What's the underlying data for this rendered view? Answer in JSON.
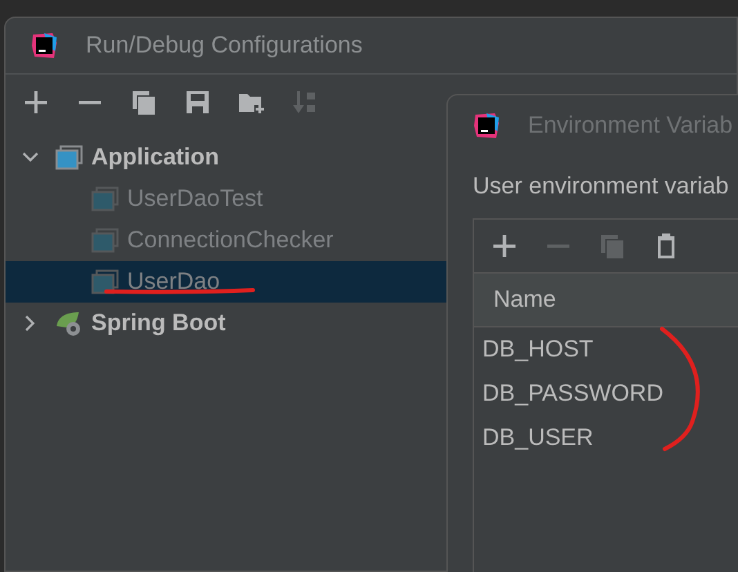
{
  "dialog": {
    "title": "Run/Debug Configurations",
    "toolbar": [
      {
        "kind": "add",
        "disabled": false
      },
      {
        "kind": "remove",
        "disabled": false
      },
      {
        "kind": "copy",
        "disabled": false
      },
      {
        "kind": "save",
        "disabled": false
      },
      {
        "kind": "folder",
        "disabled": false
      },
      {
        "kind": "sort",
        "disabled": true
      }
    ],
    "tree": [
      {
        "label": "Application",
        "kind": "application",
        "expanded": true,
        "selected": false,
        "children": [
          {
            "label": "UserDaoTest",
            "kind": "config",
            "selected": false
          },
          {
            "label": "ConnectionChecker",
            "kind": "config",
            "selected": false
          },
          {
            "label": "UserDao",
            "kind": "config",
            "selected": true
          }
        ]
      },
      {
        "label": "Spring Boot",
        "kind": "spring",
        "expanded": false,
        "selected": false
      }
    ]
  },
  "env_dialog": {
    "title": "Environment Variab",
    "label": "User environment variab",
    "toolbar": [
      {
        "kind": "add",
        "disabled": false
      },
      {
        "kind": "remove",
        "disabled": true
      },
      {
        "kind": "copy",
        "disabled": true
      },
      {
        "kind": "paste",
        "disabled": false
      }
    ],
    "columns": [
      "Name"
    ],
    "rows": [
      "DB_HOST",
      "DB_PASSWORD",
      "DB_USER"
    ]
  }
}
